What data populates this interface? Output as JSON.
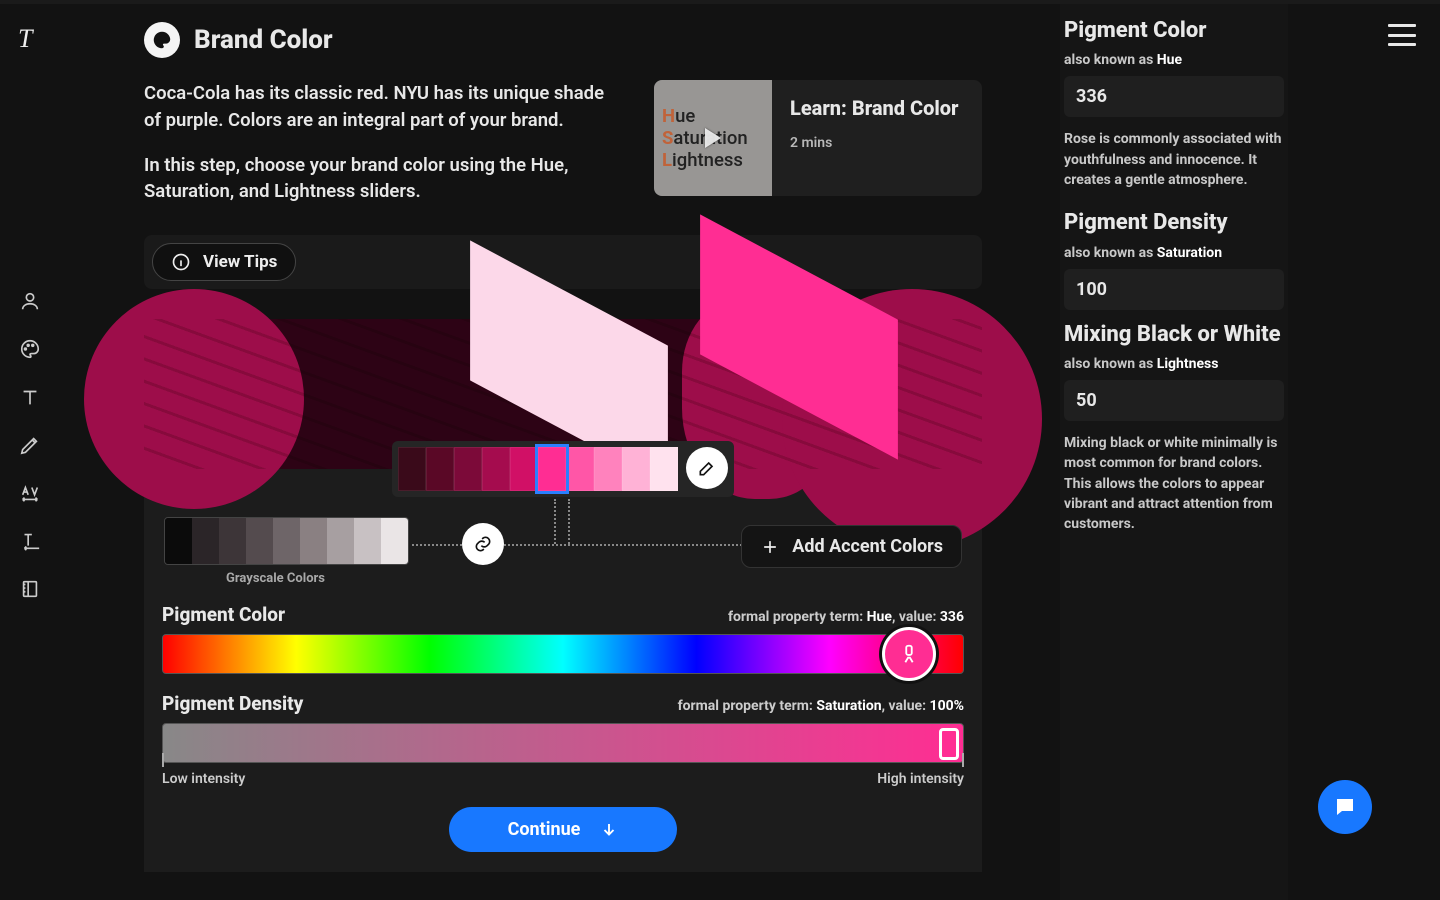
{
  "app": {
    "logo": "T"
  },
  "header": {
    "title": "Brand Color",
    "p1": "Coca-Cola has its classic red. NYU has its unique shade of purple. Colors are an integral part of your brand.",
    "p2": "In this step, choose your brand color using the Hue, Saturation, and Lightness sliders."
  },
  "learn": {
    "thumb_h": "Hue",
    "thumb_s": "Saturation",
    "thumb_l": "Lightness",
    "title": "Learn: Brand Color",
    "duration": "2 mins"
  },
  "tips": {
    "button": "View Tips"
  },
  "swatches": {
    "brand": [
      "#3a0a1a",
      "#5a0826",
      "#7c0a39",
      "#a50c4e",
      "#d11066",
      "#ff2d93",
      "#ff56a7",
      "#ff82bd",
      "#ffb2d6",
      "#ffe2ee"
    ],
    "grayscale_label": "Grayscale Colors",
    "grayscale": [
      "#0b0b0b",
      "#2b2528",
      "#3d3538",
      "#544b4e",
      "#6e6568",
      "#8a8082",
      "#a79fa1",
      "#c8c1c3",
      "#eae5e6"
    ]
  },
  "accent": {
    "button": "Add Accent Colors"
  },
  "sliders": {
    "hue": {
      "title": "Pigment Color",
      "meta_prefix": "formal property term: ",
      "meta_term": "Hue",
      "meta_value_prefix": ", value: ",
      "value": "336"
    },
    "saturation": {
      "title": "Pigment Density",
      "meta_prefix": "formal property term: ",
      "meta_term": "Saturation",
      "meta_value_prefix": ", value: ",
      "value": "100%",
      "low": "Low intensity",
      "high": "High intensity"
    }
  },
  "continue": {
    "label": "Continue"
  },
  "right": {
    "hue": {
      "title": "Pigment Color",
      "sub_prefix": "also known as ",
      "sub_term": "Hue",
      "value": "336",
      "desc": "Rose is commonly associated with youthfulness and innocence. It creates a gentle atmosphere."
    },
    "sat": {
      "title": "Pigment Density",
      "sub_prefix": "also known as ",
      "sub_term": "Saturation",
      "value": "100"
    },
    "light": {
      "title": "Mixing Black or White",
      "sub_prefix": "also known as ",
      "sub_term": "Lightness",
      "value": "50",
      "desc": "Mixing black or white minimally is most common for brand colors. This allows the colors to appear vibrant and attract attention from customers."
    }
  }
}
